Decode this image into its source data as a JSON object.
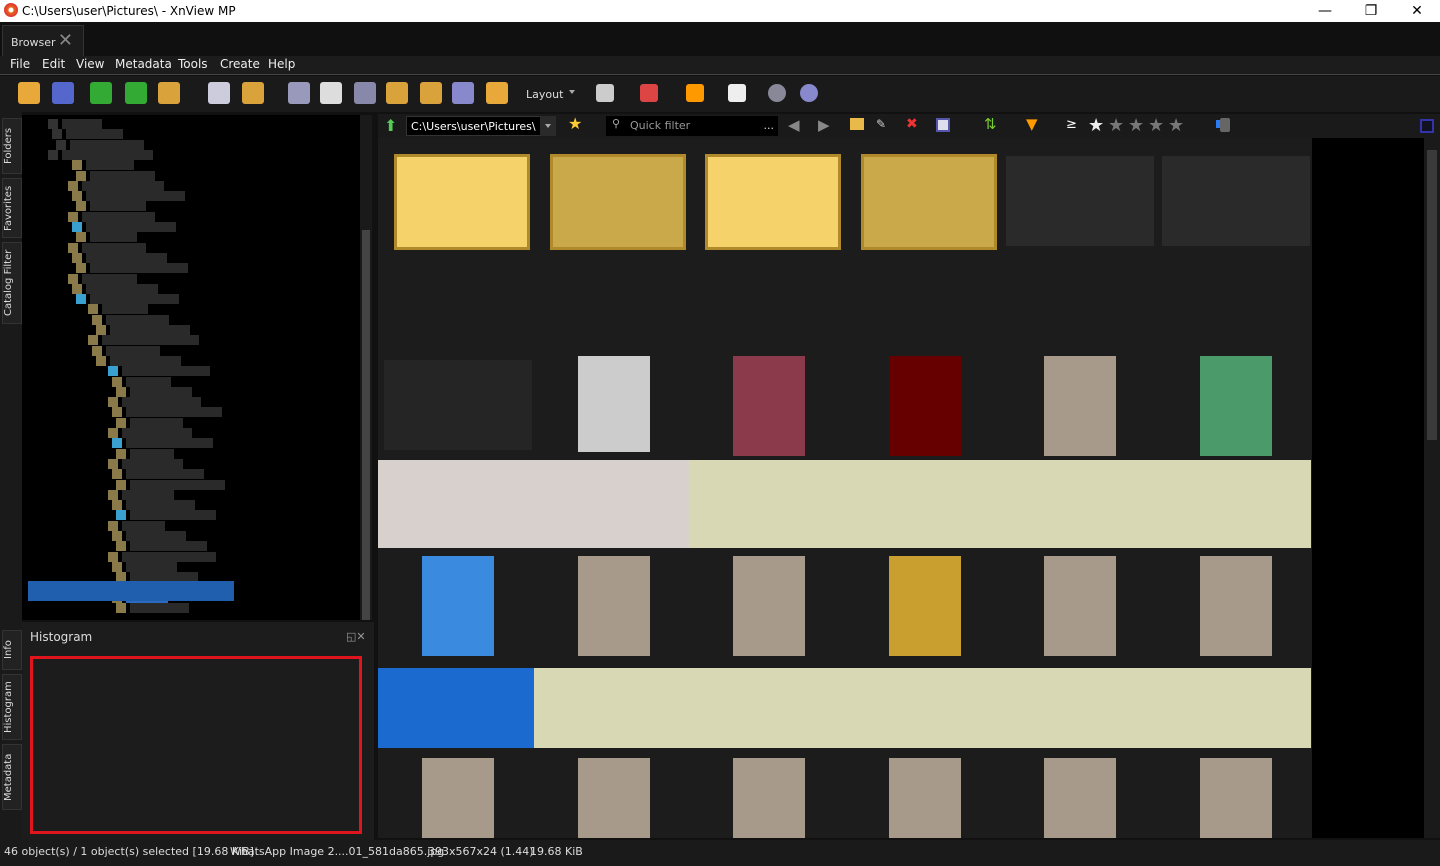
{
  "window": {
    "title": "C:\\Users\\user\\Pictures\\ - XnView MP",
    "minimize": "—",
    "maximize": "❐",
    "close": "✕"
  },
  "tab": {
    "label": "Browser",
    "close": "✕"
  },
  "menu": [
    "File",
    "Edit",
    "View",
    "Metadata",
    "Tools",
    "Create",
    "Help"
  ],
  "toolbar": {
    "layout_label": "Layout",
    "icons": [
      "view-image-icon",
      "fullscreen-icon",
      "rotate-left-icon",
      "rotate-right-icon",
      "convert-icon",
      "properties-icon",
      "copy-move-icon",
      "find-icon",
      "print-icon",
      "scan-icon",
      "batch-convert-icon",
      "batch-rename-icon",
      "screen-capture-icon",
      "slideshow-icon"
    ],
    "right_icons": [
      "thumbnail-size-icon",
      "view-mode-icon",
      "bookmark-icon",
      "compare-icon",
      "settings-icon",
      "help-icon"
    ]
  },
  "side_tabs": {
    "top": [
      "Folders",
      "Favorites",
      "Catalog Filter"
    ],
    "bottom": [
      "Info",
      "Histogram",
      "Metadata"
    ]
  },
  "histogram": {
    "title": "Histogram"
  },
  "pathbar": {
    "path": "C:\\Users\\user\\Pictures\\",
    "filter_placeholder": "Quick filter",
    "filter_more": "...",
    "rating_op": "≥",
    "stars": 5
  },
  "thumbnails": [
    [
      "folder",
      "folder-img",
      "folder",
      "folder-img",
      "doc-dark",
      "doc-dark"
    ],
    [
      "dark",
      "gray",
      "img-red",
      "img-black",
      "img-portrait",
      "img-green"
    ],
    [
      "wide-light",
      "wide-light",
      "wide-yellow",
      "wide-yellow",
      "wide-yellow",
      "wide-yellow"
    ],
    [
      "img-blue",
      "img-portrait",
      "img-portrait",
      "img-yellow",
      "img-portrait",
      "img-portrait"
    ],
    [
      "wide-blue",
      "wide-yellow",
      "wide-yellow",
      "wide-yellow",
      "wide-yellow",
      "wide-yellow"
    ],
    [
      "img-portrait",
      "img-portrait",
      "img-portrait",
      "img-portrait",
      "img-portrait",
      "img-portrait"
    ]
  ],
  "status": {
    "count": "46 object(s) / 1 object(s) selected [19.68 KiB]",
    "filename": "WhatsApp Image 2....01_581da865.jpg",
    "dimensions": "393x567x24 (1.44)",
    "size": "19.68 KiB"
  }
}
